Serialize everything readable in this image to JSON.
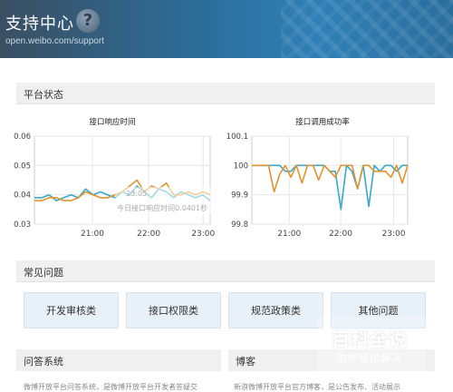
{
  "header": {
    "title": "支持中心",
    "url": "open.weibo.com/support",
    "help_icon": "question-circle-icon"
  },
  "status_panel": {
    "title": "平台状态"
  },
  "chart_data": [
    {
      "type": "line",
      "title": "接口响应时间",
      "x_ticks": [
        "21:00",
        "22:00",
        "23:00"
      ],
      "y_ticks": [
        "0.06",
        "0.05",
        "0.04",
        "0.03"
      ],
      "ylim": [
        0.03,
        0.06
      ],
      "tooltip": {
        "time": "23:05",
        "text": "今日接口响应时间0.0401秒"
      },
      "colors": [
        "#3aa9c8",
        "#e0942e"
      ],
      "series": [
        {
          "values": [
            0.039,
            0.039,
            0.04,
            0.038,
            0.039,
            0.04,
            0.039,
            0.042,
            0.04,
            0.041,
            0.04,
            0.039,
            0.041,
            0.04,
            0.043,
            0.041,
            0.039,
            0.042,
            0.041,
            0.039,
            0.041,
            0.04,
            0.039,
            0.04,
            0.038
          ]
        },
        {
          "values": [
            0.038,
            0.038,
            0.039,
            0.039,
            0.038,
            0.038,
            0.039,
            0.041,
            0.04,
            0.039,
            0.039,
            0.04,
            0.041,
            0.043,
            0.045,
            0.041,
            0.043,
            0.042,
            0.044,
            0.04,
            0.04,
            0.041,
            0.04,
            0.041,
            0.04
          ]
        }
      ]
    },
    {
      "type": "line",
      "title": "接口调用成功率",
      "x_ticks": [
        "21:00",
        "22:00",
        "23:00"
      ],
      "y_ticks": [
        "100.1",
        "100",
        "99.9",
        "99.8"
      ],
      "ylim": [
        99.8,
        100.1
      ],
      "colors": [
        "#3aa9c8",
        "#e0942e"
      ],
      "series": [
        {
          "values": [
            100,
            100,
            100,
            100,
            100,
            100,
            99.98,
            99.98,
            100,
            100,
            100,
            100,
            100,
            100,
            99.98,
            99.98,
            99.85,
            100,
            99.98,
            99.92,
            100,
            99.86,
            100,
            99.98,
            100,
            100,
            99.98,
            100,
            100
          ]
        },
        {
          "values": [
            100,
            100,
            100,
            100,
            99.91,
            99.97,
            100,
            99.96,
            100,
            99.94,
            100,
            100,
            99.95,
            100,
            99.98,
            99.96,
            100,
            100,
            100,
            99.92,
            100,
            100,
            99.98,
            99.98,
            99.98,
            99.96,
            100,
            99.94,
            100
          ]
        }
      ]
    }
  ],
  "faq": {
    "title": "常见问题",
    "buttons": [
      "开发审核类",
      "接口权限类",
      "规范政策类",
      "其他问题"
    ]
  },
  "qa": {
    "title": "问答系统",
    "snippet": "微博开放平台问答系统，是微博开放平台开发者答疑交"
  },
  "blog": {
    "title": "博客",
    "snippet": "新浪微博开放平台官方博客，是公告发布、活动展示"
  },
  "watermark": {
    "main": "百科全说",
    "sub": "助你轻松解决"
  }
}
